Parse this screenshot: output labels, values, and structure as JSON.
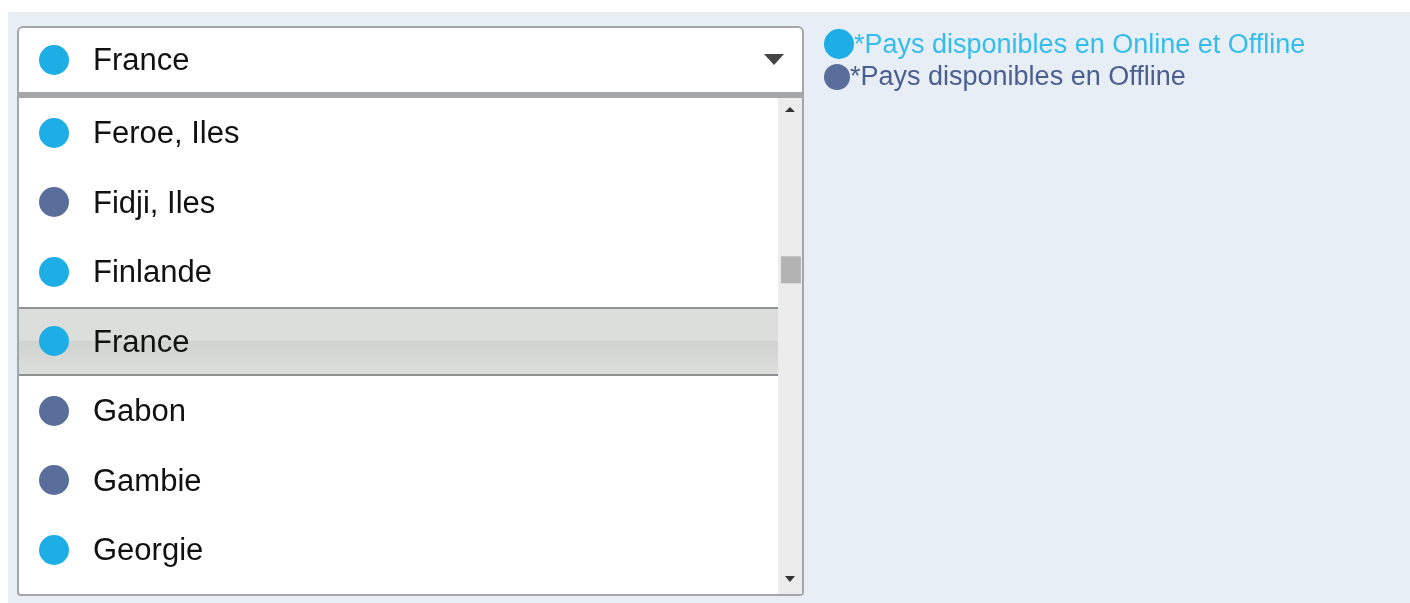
{
  "select": {
    "value": {
      "label": "France",
      "color": "#1eaee6"
    }
  },
  "dropdown": {
    "items": [
      {
        "label": "Feroe, Iles",
        "color": "#1eaee6",
        "selected": false
      },
      {
        "label": "Fidji, Iles",
        "color": "#5a6e9c",
        "selected": false
      },
      {
        "label": "Finlande",
        "color": "#1eaee6",
        "selected": false
      },
      {
        "label": "France",
        "color": "#1eaee6",
        "selected": true
      },
      {
        "label": "Gabon",
        "color": "#5a6e9c",
        "selected": false
      },
      {
        "label": "Gambie",
        "color": "#5a6e9c",
        "selected": false
      },
      {
        "label": "Georgie",
        "color": "#1eaee6",
        "selected": false
      }
    ]
  },
  "legend": [
    {
      "text": "*Pays disponibles en Online et Offline",
      "color": "#1eaee6",
      "kind": "online"
    },
    {
      "text": "*Pays disponibles en Offline",
      "color": "#5a6e9c",
      "kind": "offline"
    }
  ]
}
